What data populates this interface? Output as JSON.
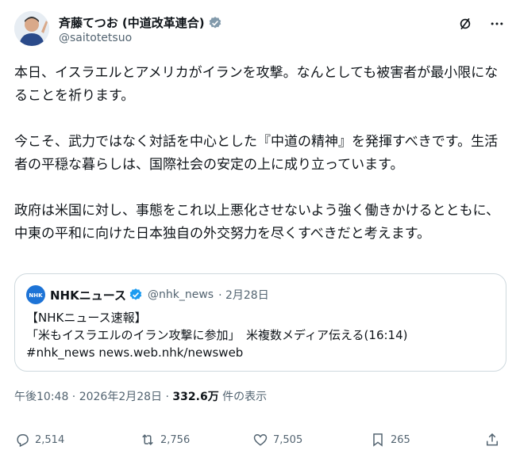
{
  "author": {
    "name": "斉藤てつお (中道改革連合)",
    "handle": "@saitotetsuo"
  },
  "tweet": {
    "paragraphs": [
      "本日、イスラエルとアメリカがイランを攻撃。なんとしても被害者が最小限になることを祈ります。",
      "今こそ、武力ではなく対話を中心とした『中道の精神』を発揮すべきです。生活者の平穏な暮らしは、国際社会の安定の上に成り立っています。",
      "政府は米国に対し、事態をこれ以上悪化させないよう強く働きかけるとともに、中東の平和に向けた日本独自の外交努力を尽くすべきだと考えます。"
    ]
  },
  "quote": {
    "name": "NHKニュース",
    "handle": "@nhk_news",
    "date": "· 2月28日",
    "avatar_text": "NHK",
    "lines": [
      "【NHKニュース速報】",
      "「米もイスラエルのイラン攻撃に参加」　米複数メディア伝える(16:14)",
      "#nhk_news news.web.nhk/newsweb"
    ]
  },
  "meta": {
    "time": "午後10:48 · 2026年2月28日 · ",
    "views": "332.6万",
    "views_suffix": " 件の表示"
  },
  "actions": {
    "replies": "2,514",
    "reposts": "2,756",
    "likes": "7,505",
    "bookmarks": "265"
  },
  "icons": [
    "verified-badge-icon",
    "grok-icon",
    "more-icon",
    "reply-icon",
    "repost-icon",
    "like-icon",
    "bookmark-icon",
    "share-icon"
  ],
  "colors": {
    "accent": "#1d9bf0",
    "muted": "#536471",
    "nhk_blue": "#1d73d6"
  }
}
